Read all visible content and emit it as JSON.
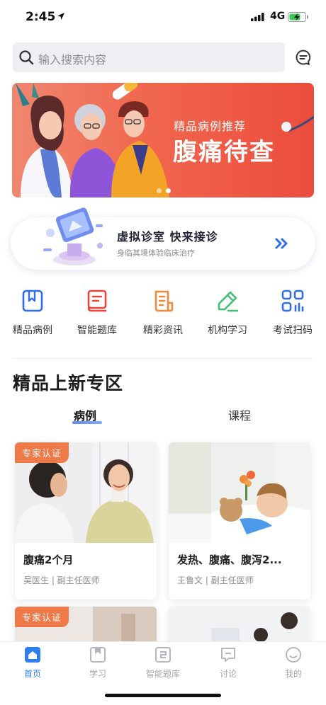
{
  "status": {
    "time": "2:45",
    "network": "4G"
  },
  "search": {
    "placeholder": "输入搜索内容"
  },
  "banner": {
    "subtitle": "精品病例推荐",
    "title": "腹痛待查",
    "slide_count": 2,
    "active_slide": 2
  },
  "clinic": {
    "title": "虚拟诊室 快来接诊",
    "subtitle": "身临其境体验临床治疗"
  },
  "quick_nav": [
    {
      "label": "精品病例",
      "icon": "bookmark-book-icon",
      "color": "#2f6ee8"
    },
    {
      "label": "智能题库",
      "icon": "question-book-icon",
      "color": "#e8453c"
    },
    {
      "label": "精彩资讯",
      "icon": "news-scroll-icon",
      "color": "#f08a3a"
    },
    {
      "label": "机构学习",
      "icon": "pencil-icon",
      "color": "#3fbf73"
    },
    {
      "label": "考试扫码",
      "icon": "scan-grid-icon",
      "color": "#2f6ee8"
    }
  ],
  "section": {
    "title": "精品上新专区"
  },
  "tabs": [
    {
      "label": "病例",
      "active": true
    },
    {
      "label": "课程",
      "active": false
    }
  ],
  "cards": [
    {
      "badge": "专家认证",
      "title": "腹痛2个月",
      "meta": "吴医生 | 副主任医师"
    },
    {
      "badge": "",
      "title": "发热、腹痛、腹泻2...",
      "meta": "王鲁文 | 副主任医师"
    },
    {
      "badge": "专家认证",
      "title": "",
      "meta": ""
    },
    {
      "badge": "",
      "title": "",
      "meta": ""
    }
  ],
  "tab_bar": [
    {
      "label": "首页",
      "icon": "home-icon",
      "active": true
    },
    {
      "label": "学习",
      "icon": "study-icon",
      "active": false
    },
    {
      "label": "智能题库",
      "icon": "question-bank-icon",
      "active": false
    },
    {
      "label": "讨论",
      "icon": "discussion-icon",
      "active": false
    },
    {
      "label": "我的",
      "icon": "profile-icon",
      "active": false
    }
  ],
  "colors": {
    "accent": "#2f7ef0",
    "badge": "#f07a47",
    "banner": "#f0664e"
  }
}
